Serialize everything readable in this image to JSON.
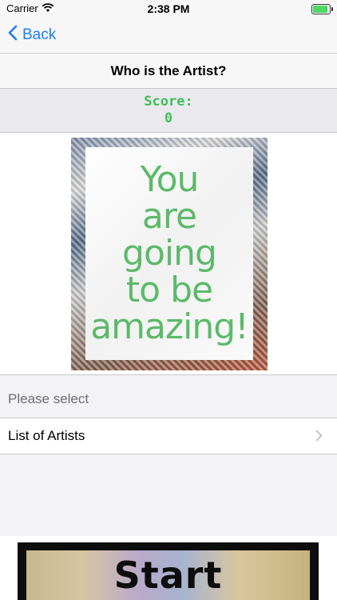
{
  "status_bar": {
    "carrier": "Carrier",
    "time": "2:38 PM",
    "battery_level": 0.9
  },
  "nav": {
    "back_label": "Back"
  },
  "title": "Who is the Artist?",
  "score": {
    "label": "Score:",
    "value": "0"
  },
  "artwork": {
    "lines": [
      "You",
      "are",
      "going",
      "to be",
      "amazing!"
    ],
    "text_color": "#5cba6a"
  },
  "section": {
    "header": "Please select"
  },
  "list": {
    "item_label": "List of Artists"
  },
  "start_button": {
    "label": "Start"
  },
  "colors": {
    "accent": "#1a7bff",
    "score": "#3fbf5a"
  }
}
